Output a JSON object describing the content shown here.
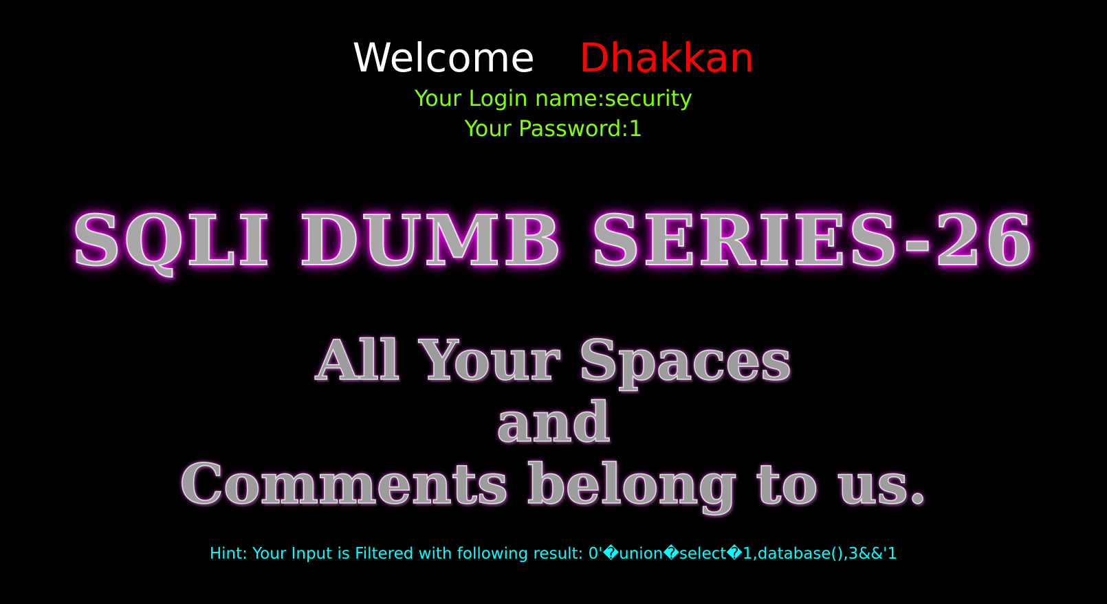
{
  "welcome": {
    "greeting": "Welcome",
    "name": "Dhakkan"
  },
  "login": {
    "name_line": "Your Login name:security",
    "password_line": "Your Password:1"
  },
  "banner": {
    "title": "SQLI DUMB SERIES-26"
  },
  "slogan": {
    "line1": "All Your Spaces",
    "line2": "and",
    "line3": "Comments belong to us."
  },
  "hint": {
    "text": "Hint: Your Input is Filtered with following result: 0'�union�select�1,database(),3&&'1"
  },
  "colors": {
    "background": "#000000",
    "greeting": "#ffffff",
    "name": "#ff0000",
    "login_text": "#7fff00",
    "hint_text": "#00ffff",
    "banner_glow": "#ff00ff"
  }
}
